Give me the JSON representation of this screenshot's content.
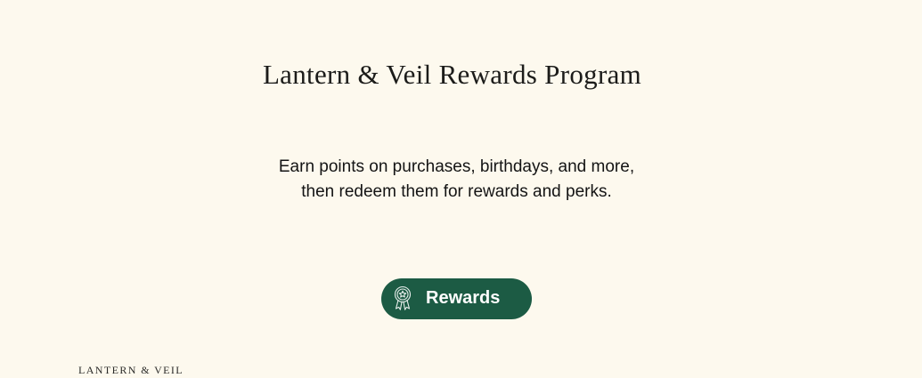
{
  "page": {
    "title": "Lantern & Veil Rewards Program",
    "description_lines": [
      "Earn points on purchases, birthdays, and more,",
      "then redeem them for rewards and perks."
    ]
  },
  "rewards_button": {
    "label": "Rewards",
    "icon": "award-ribbon-icon"
  },
  "footer": {
    "brand": "LANTERN & VEIL"
  },
  "colors": {
    "background": "#fdf9ee",
    "button": "#1c5b44",
    "button_text": "#ffffff",
    "text": "#141414"
  }
}
